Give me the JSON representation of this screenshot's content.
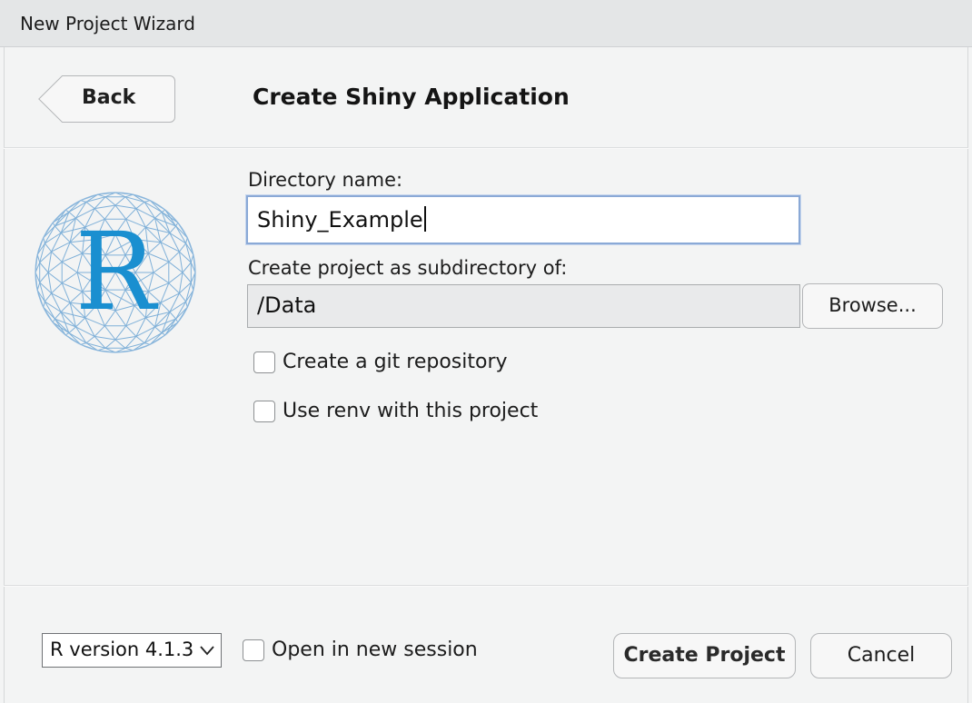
{
  "window": {
    "title": "New Project Wizard"
  },
  "header": {
    "back_label": "Back",
    "page_title": "Create Shiny Application"
  },
  "logo": {
    "letter": "R",
    "color": "#1a8fd0"
  },
  "form": {
    "directory_label": "Directory name:",
    "directory_value": "Shiny_Example",
    "subdirectory_label": "Create project as subdirectory of:",
    "subdirectory_value": "/Data",
    "browse_label": "Browse...",
    "git_label": "Create a git repository",
    "git_checked": false,
    "renv_label": "Use renv with this project",
    "renv_checked": false
  },
  "footer": {
    "r_version": "R version 4.1.3",
    "open_session_label": "Open in new session",
    "open_session_checked": false,
    "create_label": "Create Project",
    "cancel_label": "Cancel"
  },
  "colors": {
    "focus_border": "#8aa9d6",
    "window_bg": "#f3f4f4",
    "titlebar_bg": "#e4e6e7"
  }
}
